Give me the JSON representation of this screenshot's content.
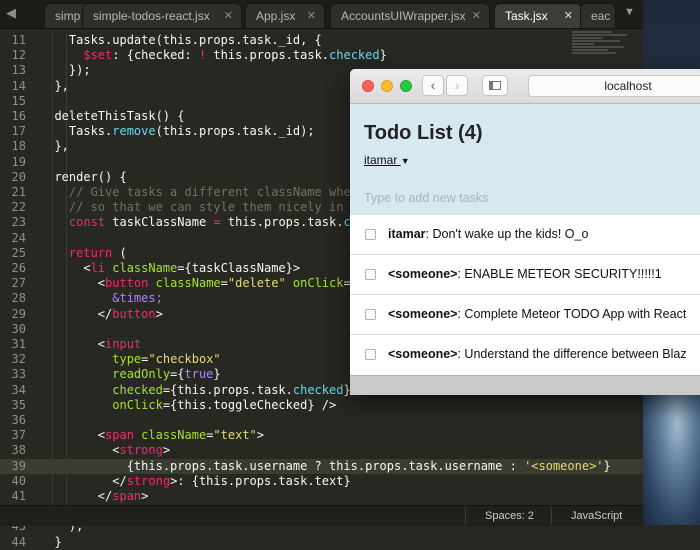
{
  "editor": {
    "tabs": [
      {
        "label": "simp",
        "active": false
      },
      {
        "label": "simple-todos-react.jsx",
        "active": false
      },
      {
        "label": "App.jsx",
        "active": false
      },
      {
        "label": "AccountsUIWrapper.jsx",
        "active": false
      },
      {
        "label": "Task.jsx",
        "active": true
      },
      {
        "label": "eac",
        "active": false
      }
    ],
    "lines": [
      {
        "n": "11",
        "tokens": [
          [
            "p",
            "    Tasks.update(this.props.task._id, {"
          ]
        ]
      },
      {
        "n": "12",
        "tokens": [
          [
            "p",
            "      "
          ],
          [
            "k",
            "$set"
          ],
          [
            "p",
            ": {checked: "
          ],
          [
            "k",
            "!"
          ],
          [
            "p",
            " this.props.task."
          ],
          [
            "f",
            "checked"
          ],
          [
            "p",
            "}"
          ]
        ]
      },
      {
        "n": "13",
        "tokens": [
          [
            "p",
            "    });"
          ]
        ]
      },
      {
        "n": "14",
        "tokens": [
          [
            "p",
            "  },"
          ]
        ]
      },
      {
        "n": "15",
        "tokens": [
          [
            "p",
            ""
          ]
        ]
      },
      {
        "n": "16",
        "tokens": [
          [
            "p",
            "  deleteThisTask() {"
          ]
        ]
      },
      {
        "n": "17",
        "tokens": [
          [
            "p",
            "    Tasks."
          ],
          [
            "f",
            "remove"
          ],
          [
            "p",
            "(this.props.task._id);"
          ]
        ]
      },
      {
        "n": "18",
        "tokens": [
          [
            "p",
            "  },"
          ]
        ]
      },
      {
        "n": "19",
        "tokens": [
          [
            "p",
            ""
          ]
        ]
      },
      {
        "n": "20",
        "tokens": [
          [
            "p",
            "  render() {"
          ]
        ]
      },
      {
        "n": "21",
        "tokens": [
          [
            "c",
            "    // Give tasks a different className when the"
          ]
        ]
      },
      {
        "n": "22",
        "tokens": [
          [
            "c",
            "    // so that we can style them nicely in CSS"
          ]
        ]
      },
      {
        "n": "23",
        "tokens": [
          [
            "k",
            "    const"
          ],
          [
            "p",
            " taskClassName "
          ],
          [
            "k",
            "="
          ],
          [
            "p",
            " this.props.task."
          ],
          [
            "f",
            "checke"
          ]
        ]
      },
      {
        "n": "24",
        "tokens": [
          [
            "p",
            ""
          ]
        ]
      },
      {
        "n": "25",
        "tokens": [
          [
            "k",
            "    return"
          ],
          [
            "p",
            " ("
          ]
        ]
      },
      {
        "n": "26",
        "tokens": [
          [
            "p",
            "      <"
          ],
          [
            "k",
            "li"
          ],
          [
            "g",
            " className"
          ],
          [
            "p",
            "={taskClassName}>"
          ]
        ]
      },
      {
        "n": "27",
        "tokens": [
          [
            "p",
            "        <"
          ],
          [
            "k",
            "button"
          ],
          [
            "g",
            " className"
          ],
          [
            "p",
            "="
          ],
          [
            "s",
            "\"delete\""
          ],
          [
            "g",
            " onClick"
          ],
          [
            "p",
            "={this"
          ]
        ]
      },
      {
        "n": "28",
        "tokens": [
          [
            "n",
            "          &times;"
          ]
        ]
      },
      {
        "n": "29",
        "tokens": [
          [
            "p",
            "        </"
          ],
          [
            "k",
            "button"
          ],
          [
            "p",
            ">"
          ]
        ]
      },
      {
        "n": "30",
        "tokens": [
          [
            "p",
            ""
          ]
        ]
      },
      {
        "n": "31",
        "tokens": [
          [
            "p",
            "        <"
          ],
          [
            "k",
            "input"
          ]
        ]
      },
      {
        "n": "32",
        "tokens": [
          [
            "g",
            "          type"
          ],
          [
            "p",
            "="
          ],
          [
            "s",
            "\"checkbox\""
          ]
        ]
      },
      {
        "n": "33",
        "tokens": [
          [
            "g",
            "          readOnly"
          ],
          [
            "p",
            "={"
          ],
          [
            "n",
            "true"
          ],
          [
            "p",
            "}"
          ]
        ]
      },
      {
        "n": "34",
        "tokens": [
          [
            "g",
            "          checked"
          ],
          [
            "p",
            "={this.props.task."
          ],
          [
            "f",
            "checked"
          ],
          [
            "p",
            "}"
          ]
        ]
      },
      {
        "n": "35",
        "tokens": [
          [
            "g",
            "          onClick"
          ],
          [
            "p",
            "={this.toggleChecked} />"
          ]
        ]
      },
      {
        "n": "36",
        "tokens": [
          [
            "p",
            ""
          ]
        ]
      },
      {
        "n": "37",
        "tokens": [
          [
            "p",
            "        <"
          ],
          [
            "k",
            "span"
          ],
          [
            "g",
            " className"
          ],
          [
            "p",
            "="
          ],
          [
            "s",
            "\"text\""
          ],
          [
            "p",
            ">"
          ]
        ]
      },
      {
        "n": "38",
        "tokens": [
          [
            "p",
            "          <"
          ],
          [
            "k",
            "strong"
          ],
          [
            "p",
            ">"
          ]
        ]
      },
      {
        "n": "39",
        "tokens": [
          [
            "p",
            "            {this.props.task.username ? this.props.task.username : "
          ],
          [
            "s",
            "'<someone>'"
          ],
          [
            "p",
            "}"
          ]
        ],
        "highlight": true
      },
      {
        "n": "40",
        "tokens": [
          [
            "p",
            "          </"
          ],
          [
            "k",
            "strong"
          ],
          [
            "p",
            ">: {this.props.task.text}"
          ]
        ]
      },
      {
        "n": "41",
        "tokens": [
          [
            "p",
            "        </"
          ],
          [
            "k",
            "span"
          ],
          [
            "p",
            ">"
          ]
        ]
      },
      {
        "n": "42",
        "tokens": [
          [
            "p",
            "      </"
          ],
          [
            "k",
            "li"
          ],
          [
            "p",
            ">"
          ]
        ]
      },
      {
        "n": "43",
        "tokens": [
          [
            "p",
            "    );"
          ]
        ]
      },
      {
        "n": "44",
        "tokens": [
          [
            "p",
            "  }"
          ]
        ]
      }
    ],
    "status": {
      "spaces": "Spaces: 2",
      "syntax": "JavaScript"
    }
  },
  "browser": {
    "url": "localhost",
    "app": {
      "title": "Todo List (4)",
      "user": "itamar",
      "new_task_placeholder": "Type to add new tasks",
      "tasks": [
        {
          "user": "itamar",
          "text": ": Don't wake up the kids! O_o"
        },
        {
          "user": "<someone>",
          "text": ": ENABLE METEOR SECURITY!!!!!1"
        },
        {
          "user": "<someone>",
          "text": ": Complete Meteor TODO App with React"
        },
        {
          "user": "<someone>",
          "text": ": Understand the difference between Blaz"
        }
      ]
    }
  },
  "colors": {
    "editor_bg": "#272822",
    "keyword": "#f92672",
    "string": "#e6db74",
    "function": "#66d9ef",
    "attr": "#a6e22e",
    "comment": "#75715e",
    "app_header": "#d7e8f1"
  }
}
